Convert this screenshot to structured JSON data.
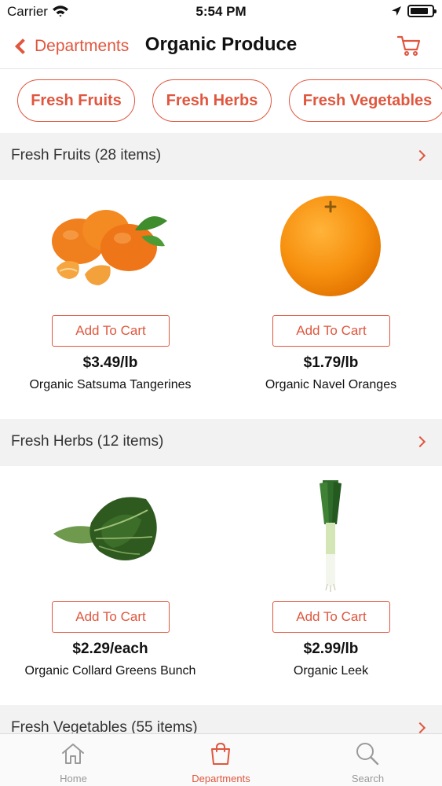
{
  "status_bar": {
    "carrier": "Carrier",
    "time": "5:54 PM"
  },
  "nav": {
    "back_label": "Departments",
    "title": "Organic Produce"
  },
  "chips": [
    "Fresh Fruits",
    "Fresh Herbs",
    "Fresh Vegetables"
  ],
  "sections": [
    {
      "header": "Fresh Fruits (28 items)",
      "products": [
        {
          "button": "Add To Cart",
          "price": "$3.49/lb",
          "name": "Organic Satsuma Tangerines"
        },
        {
          "button": "Add To Cart",
          "price": "$1.79/lb",
          "name": "Organic Navel Oranges"
        }
      ]
    },
    {
      "header": "Fresh Herbs (12 items)",
      "products": [
        {
          "button": "Add To Cart",
          "price": "$2.29/each",
          "name": "Organic Collard Greens Bunch"
        },
        {
          "button": "Add To Cart",
          "price": "$2.99/lb",
          "name": "Organic Leek"
        }
      ]
    },
    {
      "header": "Fresh Vegetables (55 items)",
      "products": []
    }
  ],
  "tabs": [
    {
      "label": "Home",
      "icon": "home-icon",
      "active": false
    },
    {
      "label": "Departments",
      "icon": "shopping-bag-icon",
      "active": true
    },
    {
      "label": "Search",
      "icon": "search-icon",
      "active": false
    }
  ],
  "colors": {
    "accent": "#e0563e",
    "section_bg": "#f2f2f2",
    "inactive_tab": "#9a9a9a"
  }
}
